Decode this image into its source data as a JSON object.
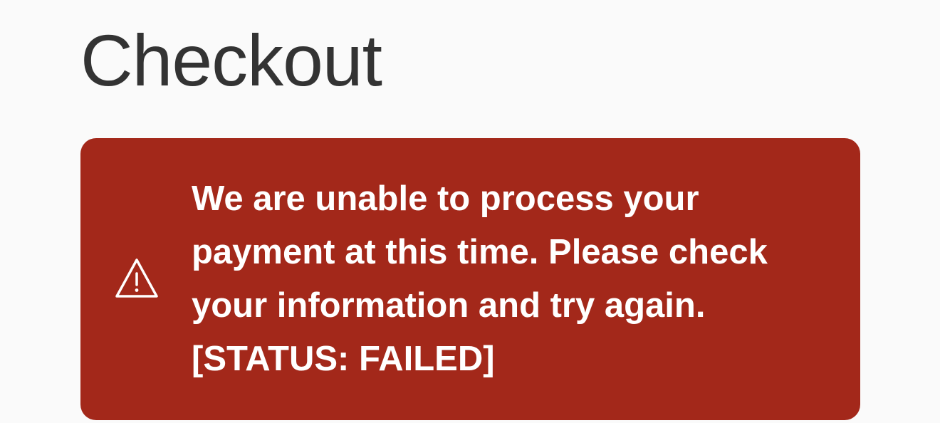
{
  "header": {
    "title": "Checkout"
  },
  "alert": {
    "icon": "warning-triangle-icon",
    "message": "We are unable to process your payment at this time. Please check your information and try again.",
    "status": "[STATUS: FAILED]",
    "background_color": "#a3281a",
    "text_color": "#ffffff"
  }
}
